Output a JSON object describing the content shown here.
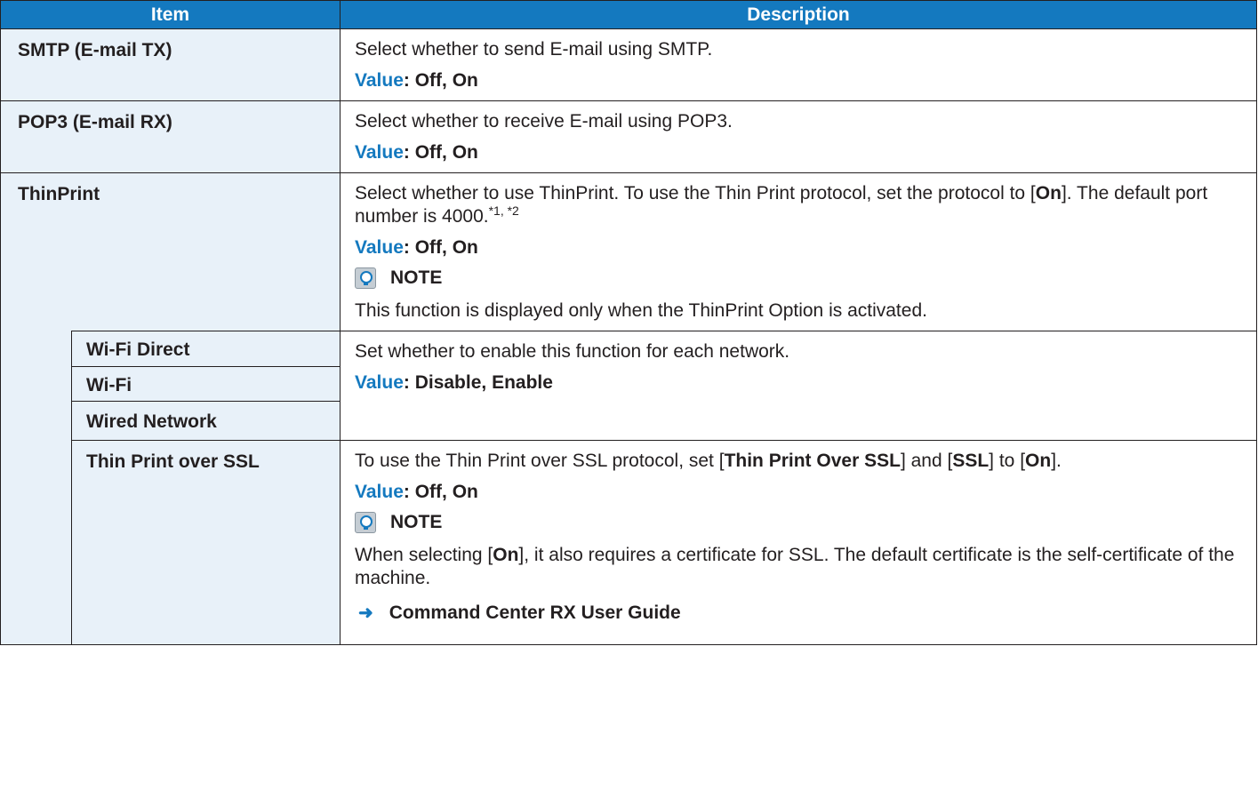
{
  "header": {
    "item": "Item",
    "description": "Description"
  },
  "rows": {
    "smtp": {
      "item": "SMTP (E-mail TX)",
      "desc": "Select whether to send E-mail using SMTP.",
      "value_label": "Value",
      "value": ": Off, On"
    },
    "pop3": {
      "item": "POP3 (E-mail RX)",
      "desc": "Select whether to receive E-mail using POP3.",
      "value_label": "Value",
      "value": ": Off, On"
    },
    "thinprint": {
      "item": "ThinPrint",
      "desc_a": "Select whether to use ThinPrint. To use the Thin Print protocol, set the protocol to [",
      "desc_on": "On",
      "desc_b": "]. The default port number is 4000.",
      "footnote": "*1, *2",
      "value_label": "Value",
      "value": ": Off, On",
      "note_title": "NOTE",
      "note_text": "This function is displayed only when the ThinPrint Option is activated."
    },
    "networks": {
      "wifi_direct": "Wi-Fi Direct",
      "wifi": "Wi-Fi",
      "wired": "Wired Network",
      "desc": "Set whether to enable this function for each network.",
      "value_label": "Value",
      "value": ": Disable, Enable"
    },
    "ssl": {
      "item": "Thin Print over SSL",
      "desc_a": "To use the Thin Print over SSL protocol, set [",
      "desc_b1": "Thin Print Over SSL",
      "desc_c": "] and [",
      "desc_b2": "SSL",
      "desc_d": "] to [",
      "desc_b3": "On",
      "desc_e": "].",
      "value_label": "Value",
      "value": ": Off, On",
      "note_title": "NOTE",
      "note_a": "When selecting [",
      "note_on": "On",
      "note_b": "], it also requires a certificate for SSL. The default certificate is the self-certificate of the machine.",
      "ref": "Command Center RX User Guide"
    }
  },
  "icons": {
    "note": "note-lightbulb-icon",
    "ref": "arrow-right-icon"
  },
  "colors": {
    "header_bg": "#1479bf",
    "item_bg": "#e8f1f9",
    "accent": "#1479bf"
  }
}
